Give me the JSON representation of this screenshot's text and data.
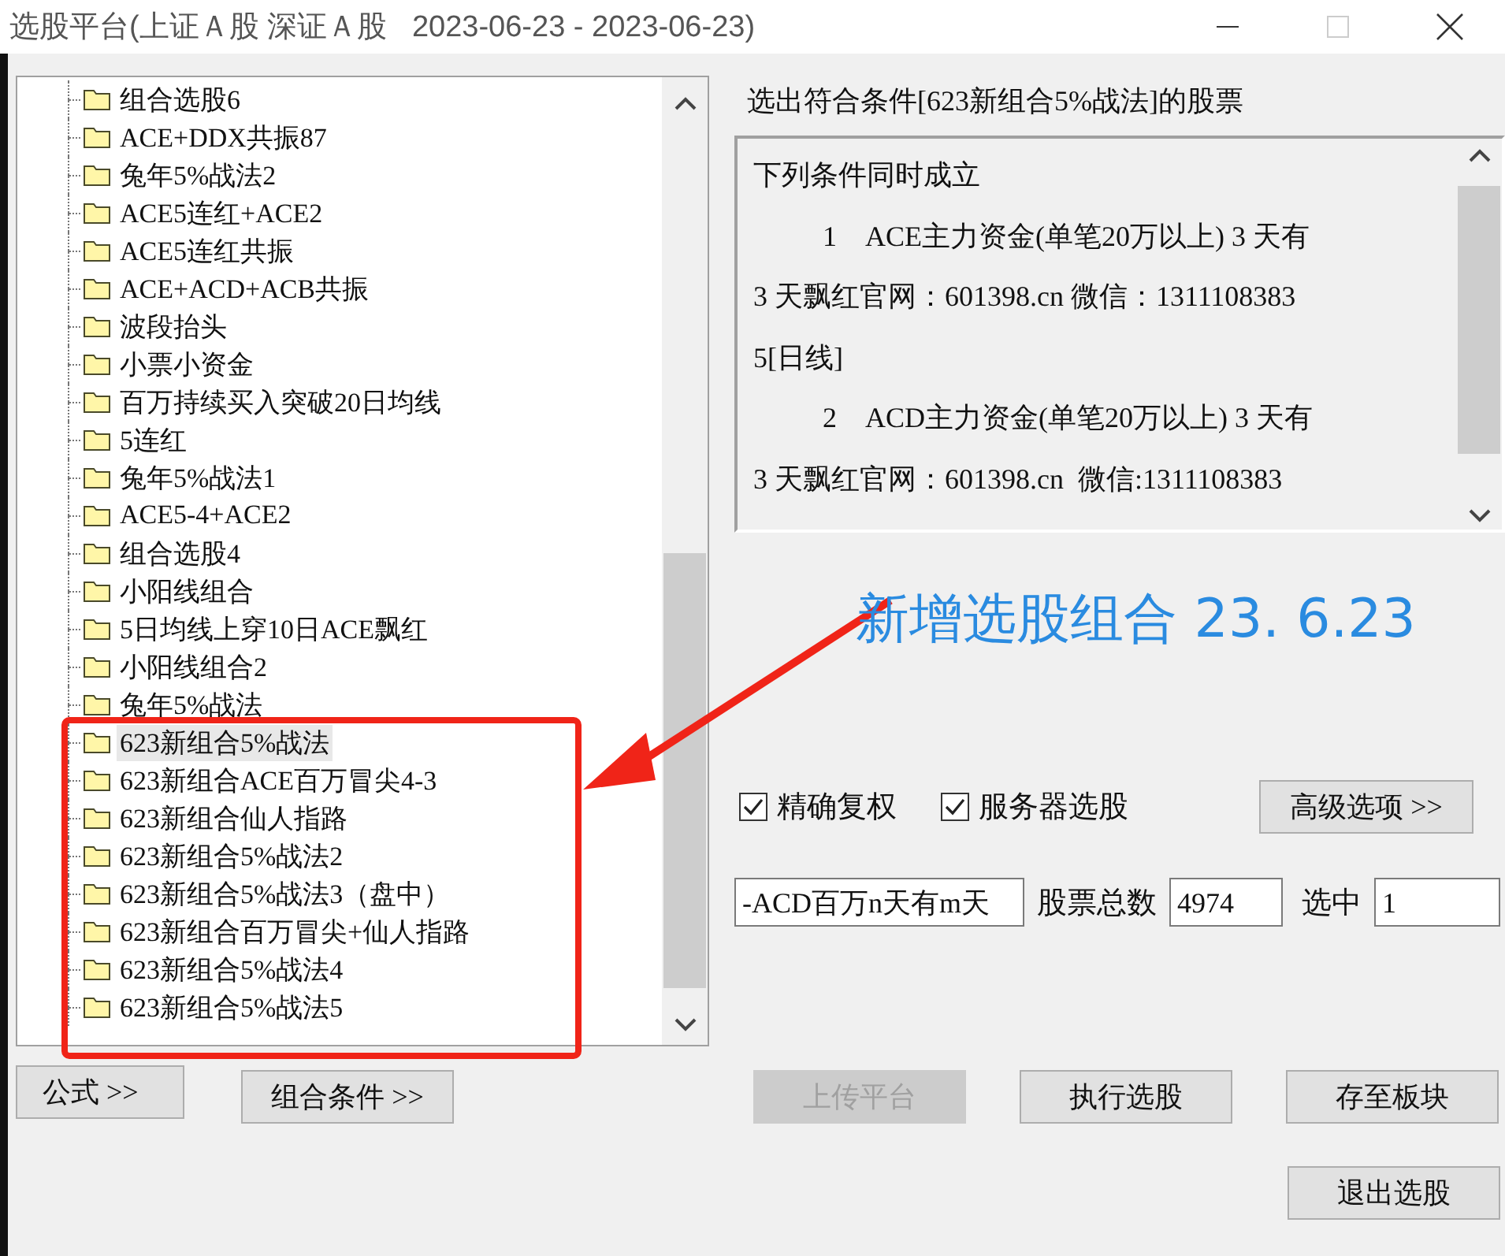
{
  "window": {
    "title": "选股平台(上证Ａ股 深证Ａ股   2023-06-23 - 2023-06-23)",
    "maximize_disabled": true
  },
  "tree": {
    "items": [
      {
        "label": "组合选股6",
        "selected": false
      },
      {
        "label": "ACE+DDX共振87",
        "selected": false
      },
      {
        "label": "兔年5%战法2",
        "selected": false
      },
      {
        "label": "ACE5连红+ACE2",
        "selected": false
      },
      {
        "label": "ACE5连红共振",
        "selected": false
      },
      {
        "label": "ACE+ACD+ACB共振",
        "selected": false
      },
      {
        "label": "波段抬头",
        "selected": false
      },
      {
        "label": "小票小资金",
        "selected": false
      },
      {
        "label": "百万持续买入突破20日均线",
        "selected": false
      },
      {
        "label": "5连红",
        "selected": false
      },
      {
        "label": "兔年5%战法1",
        "selected": false
      },
      {
        "label": "ACE5-4+ACE2",
        "selected": false
      },
      {
        "label": "组合选股4",
        "selected": false
      },
      {
        "label": "小阳线组合",
        "selected": false
      },
      {
        "label": "5日均线上穿10日ACE飘红",
        "selected": false
      },
      {
        "label": "小阳线组合2",
        "selected": false
      },
      {
        "label": "兔年5%战法",
        "selected": false
      },
      {
        "label": "623新组合5%战法",
        "selected": true
      },
      {
        "label": "623新组合ACE百万冒尖4-3",
        "selected": false
      },
      {
        "label": "623新组合仙人指路",
        "selected": false
      },
      {
        "label": "623新组合5%战法2",
        "selected": false
      },
      {
        "label": "623新组合5%战法3（盘中）",
        "selected": false
      },
      {
        "label": "623新组合百万冒尖+仙人指路",
        "selected": false
      },
      {
        "label": "623新组合5%战法4",
        "selected": false
      },
      {
        "label": "623新组合5%战法5",
        "selected": false
      }
    ]
  },
  "left_buttons": [
    "公式 >>",
    "组合条件 >>"
  ],
  "result_title": "选出符合条件[623新组合5%战法]的股票",
  "conditions": {
    "lines": [
      {
        "text": "下列条件同时成立",
        "indent": false
      },
      {
        "text": "1　ACE主力资金(单笔20万以上) 3 天有",
        "indent": true
      },
      {
        "text": "3 天飘红官网：601398.cn 微信：1311108383",
        "indent": false
      },
      {
        "text": "5[日线]",
        "indent": false
      },
      {
        "text": "2　ACD主力资金(单笔20万以上) 3 天有",
        "indent": true
      },
      {
        "text": "3 天飘红官网：601398.cn  微信:1311108383",
        "indent": false
      }
    ]
  },
  "options": [
    {
      "label": "精确复权",
      "checked": true
    },
    {
      "label": "服务器选股",
      "checked": true
    }
  ],
  "advanced_button": "高级选项 >>",
  "formula_field": "-ACD百万n天有m天",
  "total": {
    "label": "股票总数",
    "value": "4974"
  },
  "selected_count": {
    "label": "选中",
    "value": "1"
  },
  "action_buttons": [
    {
      "label": "上传平台",
      "disabled": true
    },
    {
      "label": "执行选股",
      "disabled": false
    },
    {
      "label": "存至板块",
      "disabled": false
    }
  ],
  "exit_button": "退出选股",
  "annotation": {
    "text": "新增选股组合 23. 6.23"
  }
}
